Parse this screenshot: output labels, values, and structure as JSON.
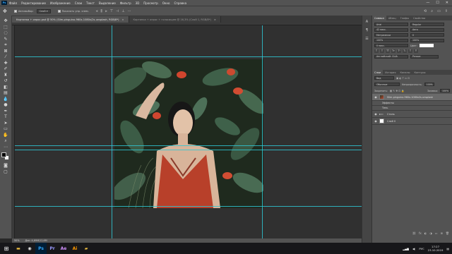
{
  "app": {
    "logo": "Ps"
  },
  "menu": [
    "Файл",
    "Редактирование",
    "Изображение",
    "Слои",
    "Текст",
    "Выделение",
    "Фильтр",
    "3D",
    "Просмотр",
    "Окно",
    "Справка"
  ],
  "window_controls": [
    "—",
    "☐",
    "✕"
  ],
  "options": {
    "tool_icon": "move-tool-icon",
    "autoselect_label": "Автовыбор:",
    "autoselect_value": "Слой",
    "transform_label": "Показать упр. элем."
  },
  "tabs": [
    {
      "label": "Картинка + опрос.psd @ 50% (Slim-pinguino-960x-1080x/2s-unsplash, RGB/8*)",
      "active": true
    },
    {
      "label": "Картинка + опрос + голосищем @ 16,3% (Слой 1, RGB/8*)",
      "active": false
    }
  ],
  "status": {
    "zoom": "50%",
    "doc": "Док: 4,69M/12,6M"
  },
  "panels": {
    "top_tabs": [
      "Символ",
      "Абзац",
      "Глифы",
      "Свойства"
    ],
    "font_name": "Arial",
    "font_style": "Regular",
    "font_size": "42 пикс.",
    "leading": "Авто",
    "tracking": "Метрически",
    "kerning": "0",
    "scale_v": "100%",
    "scale_h": "100%",
    "baseline": "0 пикс.",
    "color_label": "Цвет:",
    "language": "Английский: США",
    "aa": "Резкое",
    "layers_tabs": [
      "Слои",
      "История",
      "Каналы",
      "Контуры"
    ],
    "kind_label": "Вид",
    "blend_mode": "Обычные",
    "opacity_label": "Непрозрачность:",
    "opacity": "100%",
    "lock_label": "Закрепить:",
    "fill_label": "Заливка:",
    "fill": "100%",
    "layers": [
      {
        "name": "Slim-pinguino-960x-1080x2s-unsplash",
        "type": "photo",
        "selected": true
      },
      {
        "name": "Эффекты",
        "type": "sub",
        "selected": false
      },
      {
        "name": "Тень",
        "type": "sub",
        "selected": false
      },
      {
        "name": "Стиль",
        "type": "sub",
        "selected": false
      },
      {
        "name": "Слой 0",
        "type": "white",
        "selected": false
      }
    ]
  },
  "taskbar": {
    "apps": [
      "explorer-icon",
      "chrome-icon",
      "photoshop-icon",
      "premiere-icon",
      "aftereffects-icon",
      "illustrator-icon",
      "folder-icon"
    ],
    "lang": "РУС",
    "time": "17:27",
    "date": "23.10.2019"
  }
}
